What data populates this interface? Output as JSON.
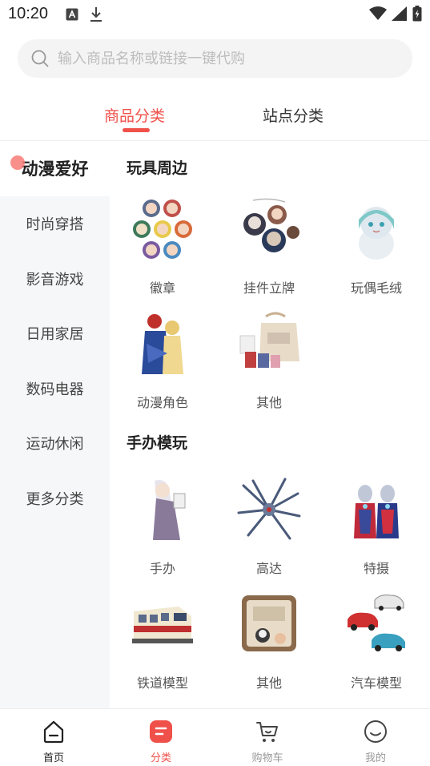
{
  "status_bar": {
    "time": "10:20"
  },
  "search": {
    "placeholder": "输入商品名称或链接一键代购"
  },
  "tabs": [
    {
      "label": "商品分类",
      "active": true
    },
    {
      "label": "站点分类",
      "active": false
    }
  ],
  "sidebar": {
    "items": [
      {
        "label": "动漫爱好",
        "active": true
      },
      {
        "label": "时尚穿搭"
      },
      {
        "label": "影音游戏"
      },
      {
        "label": "日用家居"
      },
      {
        "label": "数码电器"
      },
      {
        "label": "运动休闲"
      },
      {
        "label": "更多分类"
      }
    ]
  },
  "sections": [
    {
      "title": "玩具周边",
      "items": [
        {
          "label": "徽章"
        },
        {
          "label": "挂件立牌"
        },
        {
          "label": "玩偶毛绒"
        },
        {
          "label": "动漫角色"
        },
        {
          "label": "其他"
        }
      ]
    },
    {
      "title": "手办模玩",
      "items": [
        {
          "label": "手办"
        },
        {
          "label": "高达"
        },
        {
          "label": "特摄"
        },
        {
          "label": "铁道模型"
        },
        {
          "label": "其他"
        },
        {
          "label": "汽车模型"
        }
      ]
    }
  ],
  "bottom_nav": [
    {
      "label": "首页",
      "icon": "home-icon"
    },
    {
      "label": "分类",
      "icon": "category-icon",
      "active": true
    },
    {
      "label": "购物车",
      "icon": "cart-icon"
    },
    {
      "label": "我的",
      "icon": "profile-icon"
    }
  ],
  "colors": {
    "accent": "#f0504a",
    "sidebar_bg": "#f6f7f9"
  }
}
